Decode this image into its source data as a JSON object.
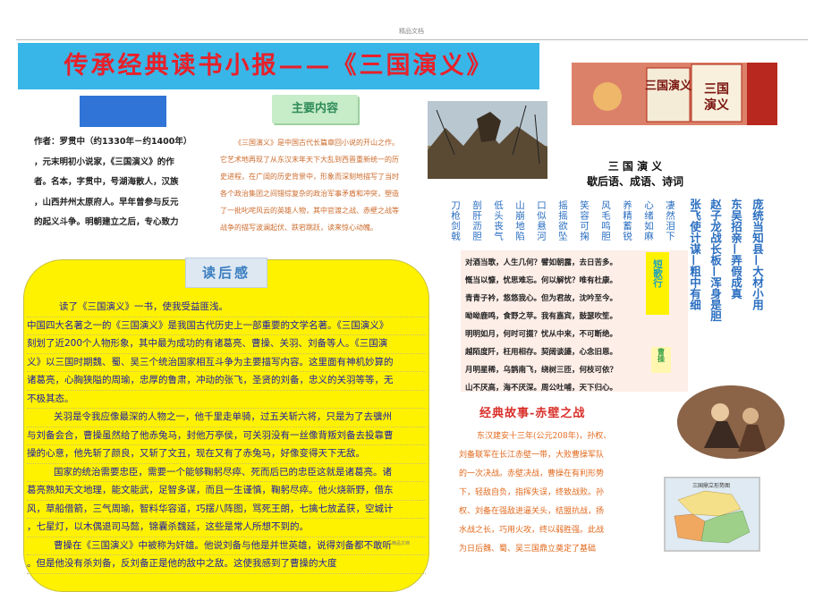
{
  "header": {
    "small_label": "精品文档"
  },
  "title": {
    "text": "传承经典读书小报——《三国演义》"
  },
  "author": {
    "lines": [
      "作者：罗贯中（约1330年－约1400年）",
      "，元末明初小说家，《三国演义》的作",
      "者。名本，字贯中，号湖海散人，汉族",
      "，山西并州太原府人。早年曾参与反元",
      "的起义斗争。明朝建立之后，专心致力"
    ]
  },
  "main_content": {
    "tag": "主要内容",
    "text": "《三国演义》是中国古代长篇章回小说的开山之作。它艺术地再现了从东汉末年天下大乱到西晋重新统一的历史进程，在广阔的历史背景中，形象而深刻地描写了当时各个政治集团之间错综复杂的政治军事矛盾和冲突，塑造了一批叱咤风云的英雄人物，其中官渡之战、赤壁之战等战争的描写波澜起伏、跌宕跳跃，读来惊心动魄。"
  },
  "review": {
    "tag": "读后感",
    "lines": [
      "读了《三国演义》一书，使我受益匪浅。",
      "中国四大名著之一的《三国演义》是我国古代历史上一部重要的文学名著。《三国演义》",
      "刻划了近200个人物形象，其中最为成功的有诸葛亮、曹操、关羽、刘备等人。《三国演",
      "义》以三国时期魏、蜀、吴三个统治国家相互斗争为主要描写内容。这里面有神机妙算的",
      "诸葛亮，心胸狭隘的周瑜，忠厚的鲁肃，冲动的张飞，圣贤的刘备，忠义的关羽等等，无",
      "不极其态。",
      "关羽是令我应像最深的人物之一，他千里走单骑，过五关斩六将，只是为了去骥州",
      "与刘备会合，曹操虽然给了他赤兔马，封他万亭侯，可关羽没有一丝像背叛刘备去投靠曹",
      "操的心意，他先斩了颜良，又斩了文丑，现在又有了赤兔马，好像变得天下无敌。",
      "国家的统治需要忠臣，需要一个能够鞠躬尽瘁、死而后已的忠臣这就是诸葛亮。诸",
      "葛亮熟知天文地理，能文能武，足智多谋，而且一生谨慎，鞠躬尽瘁。他火烧新野，借东",
      "风，草船借箭，三气周瑜，智料华容道，巧摆八阵图，骂死王朗，七擒七放孟获，空城计",
      "，七星灯，以木偶退司马懿，锦囊杀魏延，这些是常人所想不到的。",
      "曹操在《三国演义》中被称为奸雄。他说刘备与他是并世英雄，说得刘备都不敢听",
      "。但是他没有杀刘备，反刘备正是他的敌中之敌。这使我感到了曹操的大度"
    ]
  },
  "idioms": {
    "title_line1": "三 国 演 义",
    "title_line2": "歇后语、成语、诗词",
    "small_cols": [
      "刀枪剑戟",
      "剖肝沥胆",
      "低头丧气",
      "山崩地陷",
      "口似悬河",
      "摇摇欲坠",
      "笑容可掬",
      "风毛鸣胆",
      "养精蓄锐",
      "心绪如麻",
      "凄然泪下"
    ],
    "big_cols": [
      "张飞使计谋—粗中有细",
      "赵子龙战长板—浑身是胆",
      "东吴招亲—弄假成真",
      "庞统当知县—大材小用"
    ]
  },
  "poem": {
    "lines": [
      "对酒当歌，人生几何？譬如朝露，去日苦多。",
      "慨当以慷，忧思难忘。何以解忧？唯有杜康。",
      "青青子衿，悠悠我心。但为君故，沈吟至今。",
      "呦呦鹿鸣，食野之苹。我有嘉宾，鼓瑟吹笙。",
      "明明如月，何时可掇？忧从中来，不可断绝。",
      "越陌度阡，枉用相存。契阔谈讌，心念旧恩。",
      "月明星稀，乌鹊南飞，绕树三匝，何枝可依？",
      "山不厌高，海不厌深。周公吐哺，天下归心。"
    ],
    "label": "短歌行",
    "author": "曹操"
  },
  "story": {
    "title": "经典故事-赤壁之战",
    "lines": [
      "东汉建安十三年(公元208年)，孙权、",
      "刘备联军在长江赤壁一带，大败曹操军队",
      "的一次决战。赤壁决战，曹操在有利形势",
      "下，轻敌自负，指挥失误，终致战败。孙",
      "权、刘备在强敌进逼关头，结盟抗战，扬",
      "水战之长，巧用火攻，终以弱胜强。此战",
      "为日后魏、蜀、吴三国鼎立奠定了基础"
    ]
  },
  "book_cover": {
    "title": "三国演义"
  },
  "map": {
    "title": "三国鼎立形势图"
  },
  "footer": {
    "label": "精品文档"
  }
}
